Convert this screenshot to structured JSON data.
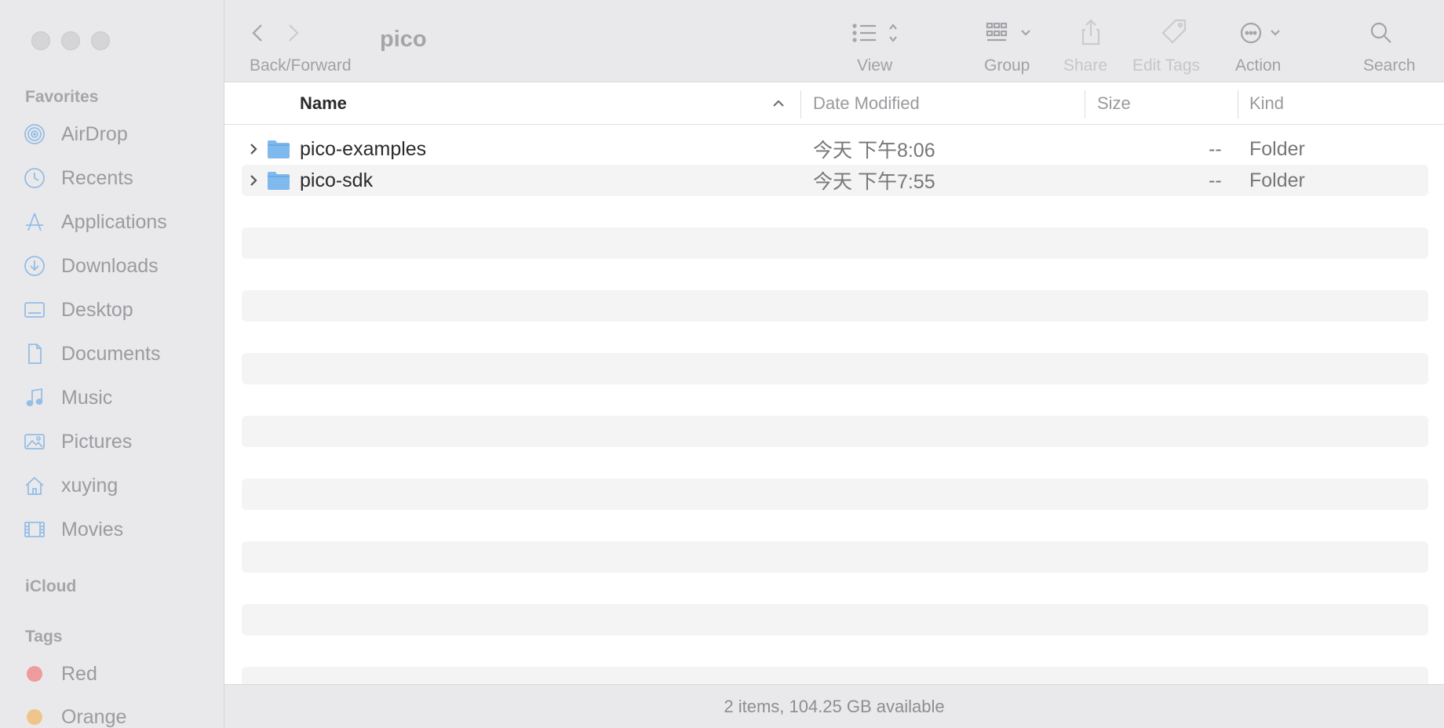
{
  "window": {
    "title": "pico"
  },
  "toolbar": {
    "nav_label": "Back/Forward",
    "view_label": "View",
    "group_label": "Group",
    "share_label": "Share",
    "edit_tags_label": "Edit Tags",
    "action_label": "Action",
    "search_label": "Search"
  },
  "sidebar": {
    "favorites_title": "Favorites",
    "favorites": [
      {
        "label": "AirDrop",
        "icon": "airdrop-icon"
      },
      {
        "label": "Recents",
        "icon": "clock-icon"
      },
      {
        "label": "Applications",
        "icon": "applications-icon"
      },
      {
        "label": "Downloads",
        "icon": "download-icon"
      },
      {
        "label": "Desktop",
        "icon": "desktop-icon"
      },
      {
        "label": "Documents",
        "icon": "document-icon"
      },
      {
        "label": "Music",
        "icon": "music-icon"
      },
      {
        "label": "Pictures",
        "icon": "pictures-icon"
      },
      {
        "label": "xuying",
        "icon": "home-icon"
      },
      {
        "label": "Movies",
        "icon": "film-icon"
      }
    ],
    "icloud_title": "iCloud",
    "tags_title": "Tags",
    "tags": [
      {
        "label": "Red",
        "color": "#ef9a9c"
      },
      {
        "label": "Orange",
        "color": "#f0c58c"
      }
    ]
  },
  "columns": {
    "name": "Name",
    "date": "Date Modified",
    "size": "Size",
    "kind": "Kind"
  },
  "files": [
    {
      "name": "pico-examples",
      "date": "今天 下午8:06",
      "size": "--",
      "kind": "Folder"
    },
    {
      "name": "pico-sdk",
      "date": "今天 下午7:55",
      "size": "--",
      "kind": "Folder"
    }
  ],
  "status": {
    "text": "2 items, 104.25 GB available"
  },
  "colors": {
    "sidebar_bg": "#e9e9eb",
    "accent_icon": "#95bde6",
    "folder": "#7fb9ee"
  }
}
